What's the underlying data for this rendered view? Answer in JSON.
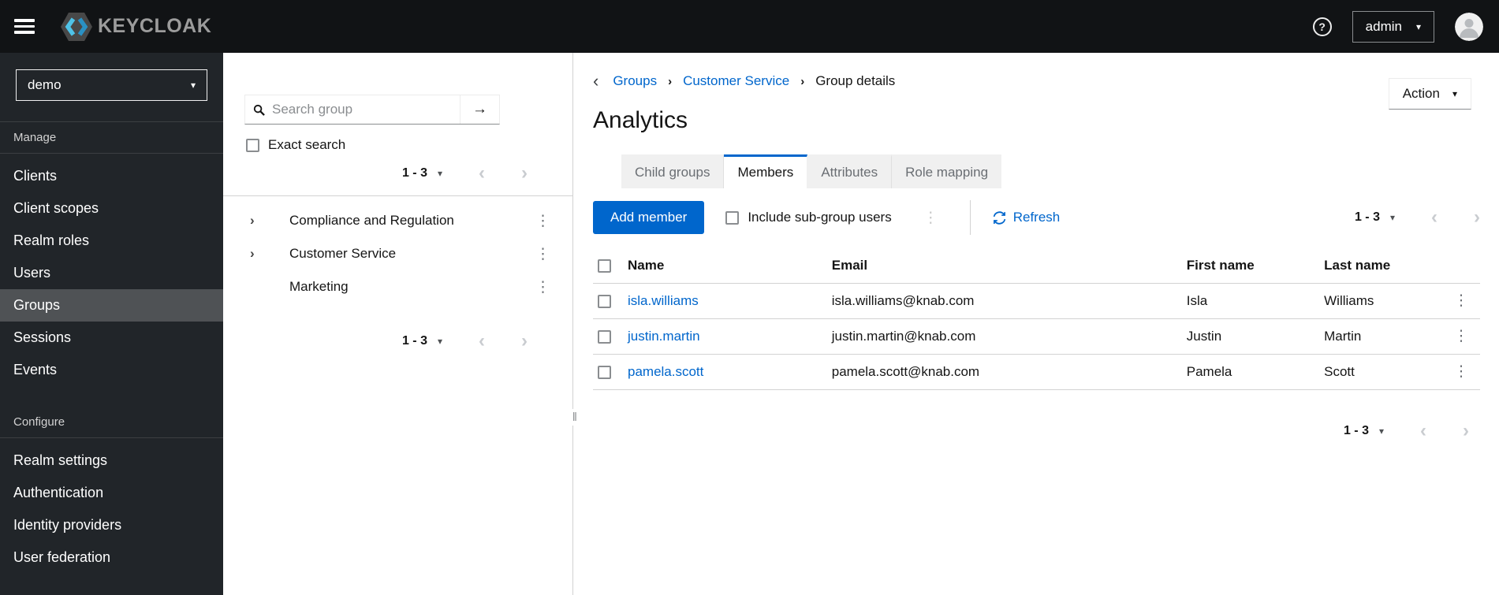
{
  "colors": {
    "accent": "#0066cc",
    "topbar_bg": "#111315",
    "sidebar_bg": "#212529",
    "sidebar_selected_bg": "#4f5255",
    "tab_inactive_bg": "#f0f0f0",
    "border": "#d2d2d2",
    "muted_text": "#6a6e73"
  },
  "topbar": {
    "brand": "KEYCLOAK",
    "user": "admin",
    "icons": {
      "hamburger": "menu-icon",
      "help": "?",
      "avatar": "user-avatar"
    }
  },
  "sidebar": {
    "realm": "demo",
    "sections": [
      {
        "label": "Manage",
        "items": [
          {
            "label": "Clients"
          },
          {
            "label": "Client scopes"
          },
          {
            "label": "Realm roles"
          },
          {
            "label": "Users"
          },
          {
            "label": "Groups"
          },
          {
            "label": "Sessions"
          },
          {
            "label": "Events"
          }
        ]
      },
      {
        "label": "Configure",
        "items": [
          {
            "label": "Realm settings"
          },
          {
            "label": "Authentication"
          },
          {
            "label": "Identity providers"
          },
          {
            "label": "User federation"
          }
        ]
      }
    ],
    "selected_item": "Groups"
  },
  "tree_panel": {
    "search_placeholder": "Search group",
    "search_go": "→",
    "exact_search_label": "Exact search",
    "pagination_top": "1 - 3",
    "pagination_bottom": "1 - 3",
    "groups": [
      {
        "name": "Compliance and Regulation",
        "expandable": true
      },
      {
        "name": "Customer Service",
        "expandable": true
      },
      {
        "name": "Marketing",
        "expandable": false
      }
    ]
  },
  "main": {
    "breadcrumb": {
      "back": "‹",
      "items": [
        "Groups",
        "Customer Service",
        "Group details"
      ]
    },
    "title": "Analytics",
    "action_label": "Action",
    "tabs": [
      {
        "label": "Child groups"
      },
      {
        "label": "Members"
      },
      {
        "label": "Attributes"
      },
      {
        "label": "Role mapping"
      }
    ],
    "active_tab": "Members",
    "toolbar": {
      "add_member_label": "Add member",
      "include_subgroups_label": "Include sub-group users",
      "refresh_label": "Refresh",
      "pagination": "1 - 3"
    },
    "table": {
      "columns": [
        "Name",
        "Email",
        "First name",
        "Last name"
      ],
      "rows": [
        {
          "name": "isla.williams",
          "email": "isla.williams@knab.com",
          "first": "Isla",
          "last": "Williams"
        },
        {
          "name": "justin.martin",
          "email": "justin.martin@knab.com",
          "first": "Justin",
          "last": "Martin"
        },
        {
          "name": "pamela.scott",
          "email": "pamela.scott@knab.com",
          "first": "Pamela",
          "last": "Scott"
        }
      ]
    },
    "bottom_pagination": "1 - 3"
  }
}
